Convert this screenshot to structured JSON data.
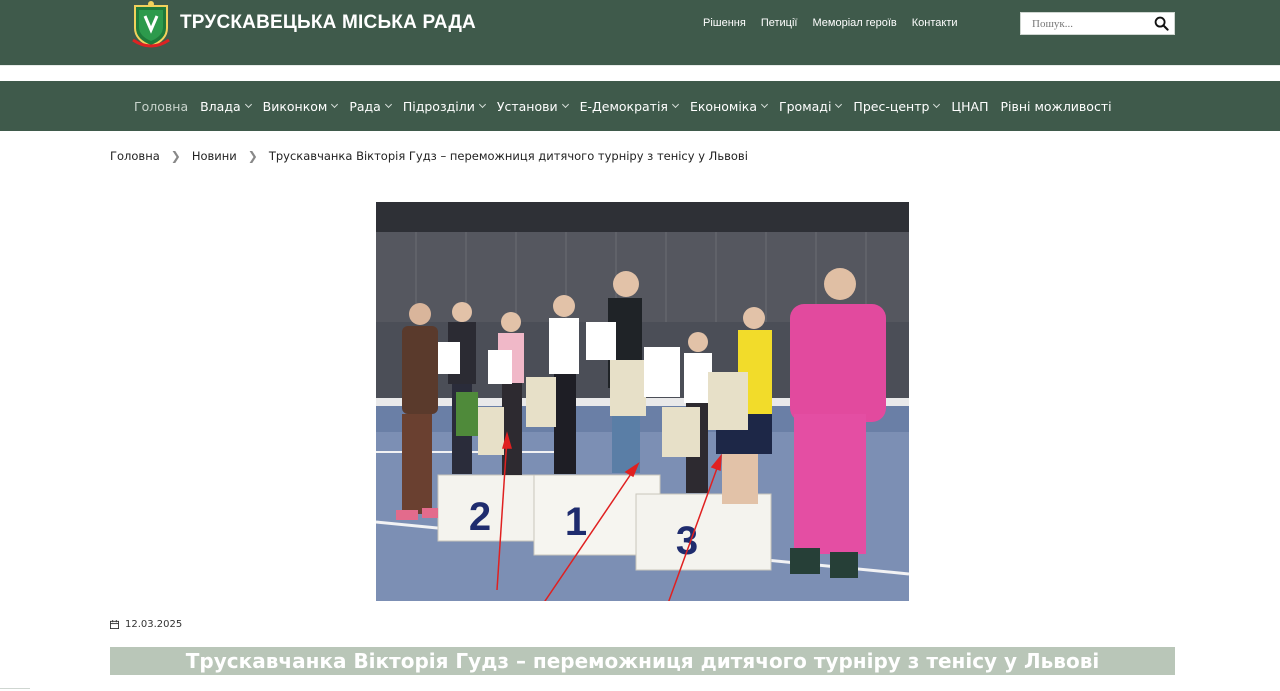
{
  "header": {
    "site_title": "ТРУСКАВЕЦЬКА МІСЬКА РАДА",
    "top_links": [
      "Рішення",
      "Петиції",
      "Меморіал героїв",
      "Контакти"
    ],
    "search_placeholder": "Пошук..."
  },
  "nav": {
    "items": [
      {
        "label": "Головна",
        "dropdown": false,
        "active": true
      },
      {
        "label": "Влада",
        "dropdown": true
      },
      {
        "label": "Виконком",
        "dropdown": true
      },
      {
        "label": "Рада",
        "dropdown": true
      },
      {
        "label": "Підрозділи",
        "dropdown": true
      },
      {
        "label": "Установи",
        "dropdown": true
      },
      {
        "label": "Е-Демократія",
        "dropdown": true
      },
      {
        "label": "Економіка",
        "dropdown": true
      },
      {
        "label": "Громаді",
        "dropdown": true
      },
      {
        "label": "Прес-центр",
        "dropdown": true
      },
      {
        "label": "ЦНАП",
        "dropdown": false
      },
      {
        "label": "Рівні можливості",
        "dropdown": false
      }
    ]
  },
  "breadcrumb": {
    "home": "Головна",
    "section": "Новини",
    "current": "Трускавчанка Вікторія Гудз – переможниця дитячого турніру з тенісу у Львові",
    "separator": "❯"
  },
  "photo": {
    "podium_labels": [
      "2",
      "1",
      "3"
    ]
  },
  "article": {
    "date": "12.03.2025",
    "title": "Трускавчанка Вікторія Гудз – переможниця дитячого турніру з тенісу у Львові"
  },
  "colors": {
    "header_bg": "#3f5a4b",
    "title_bar_bg": "#b9c6b8",
    "annotation_arrows": "#e02020"
  }
}
